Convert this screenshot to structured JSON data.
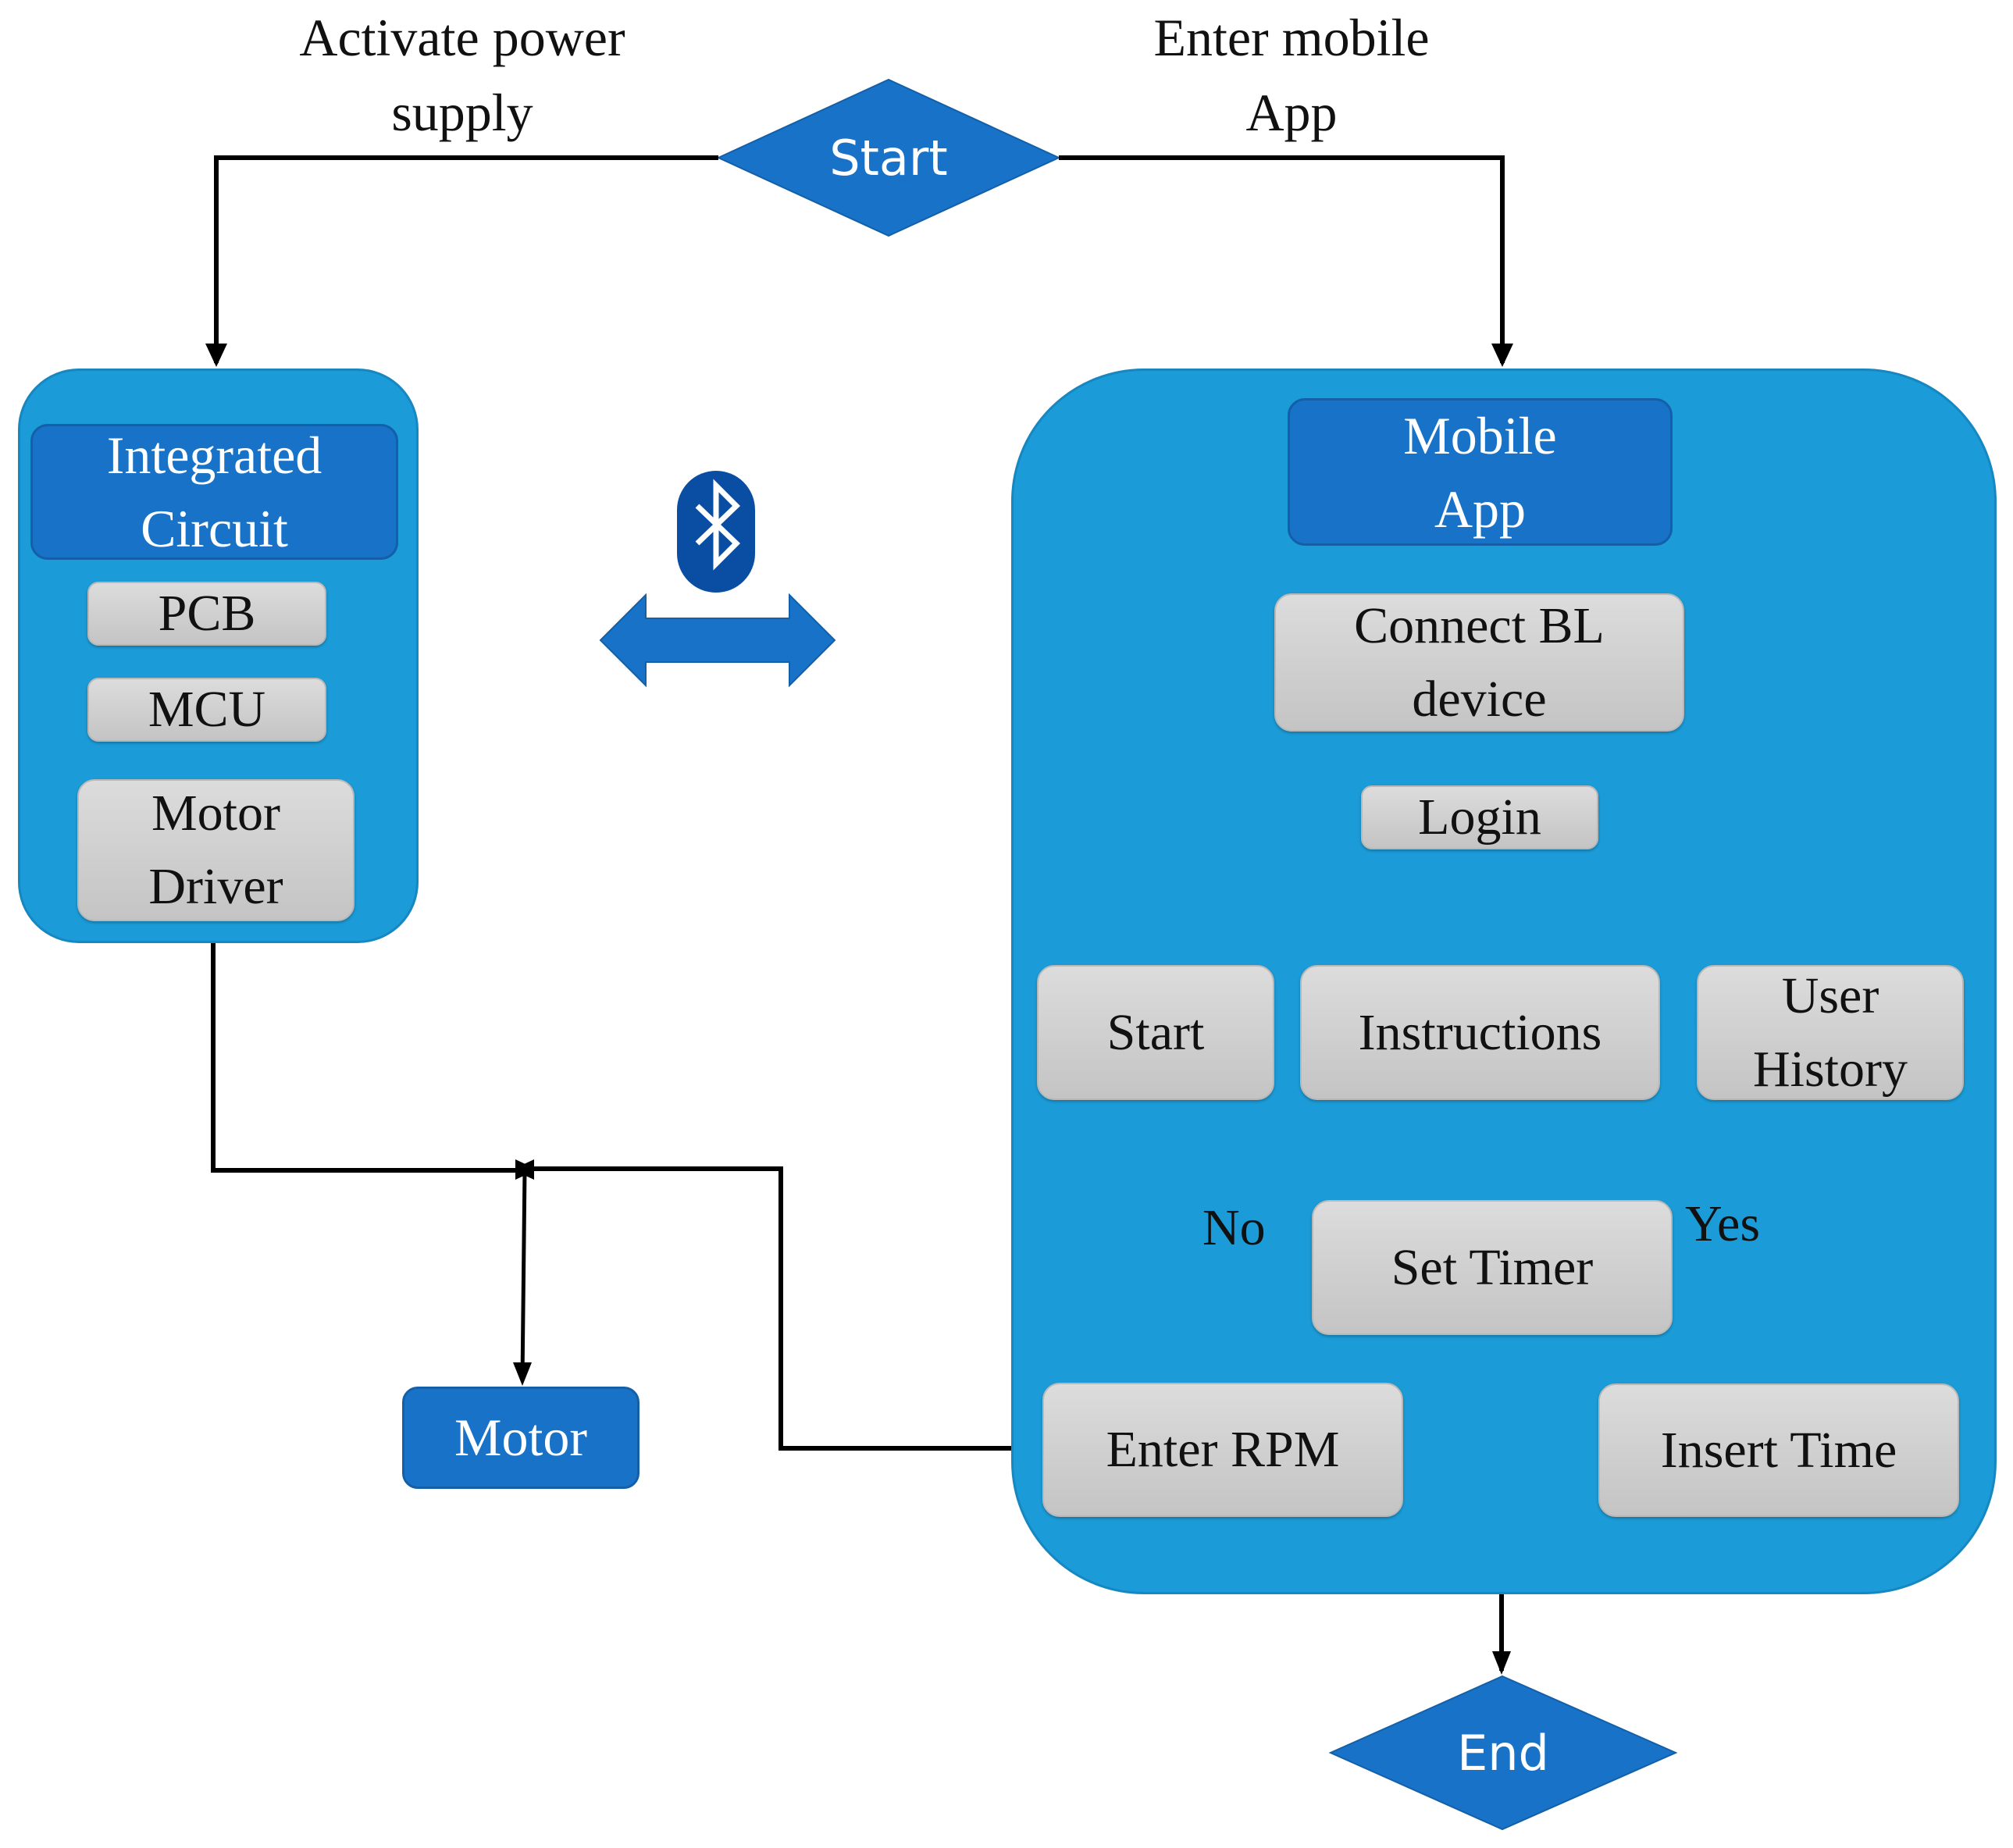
{
  "annotations": {
    "power_line1": "Activate power",
    "power_line2": "supply",
    "app_line1": "Enter mobile",
    "app_line2": "App"
  },
  "terminals": {
    "start": "Start",
    "end": "End"
  },
  "hardware": {
    "header_line1": "Integrated",
    "header_line2": "Circuit",
    "items": [
      "PCB",
      "MCU",
      "Motor",
      "Driver"
    ]
  },
  "connection": {
    "icon": "bluetooth-icon",
    "arrow": "double-arrow"
  },
  "motor": {
    "label": "Motor"
  },
  "mobile_app": {
    "header_line1": "Mobile",
    "header_line2": "App",
    "connect_line1": "Connect BL",
    "connect_line2": "device",
    "login": "Login",
    "menu": {
      "start": "Start",
      "instructions": "Instructions",
      "history_line1": "User",
      "history_line2": "History"
    },
    "set_timer": "Set Timer",
    "branch_no": "No",
    "branch_yes": "Yes",
    "enter_rpm": "Enter RPM",
    "insert_time": "Insert Time"
  },
  "colors": {
    "container": "#1b9bd7",
    "header": "#1872c8",
    "box": "#d0d0d0",
    "bluetooth": "#0a4ea3"
  }
}
